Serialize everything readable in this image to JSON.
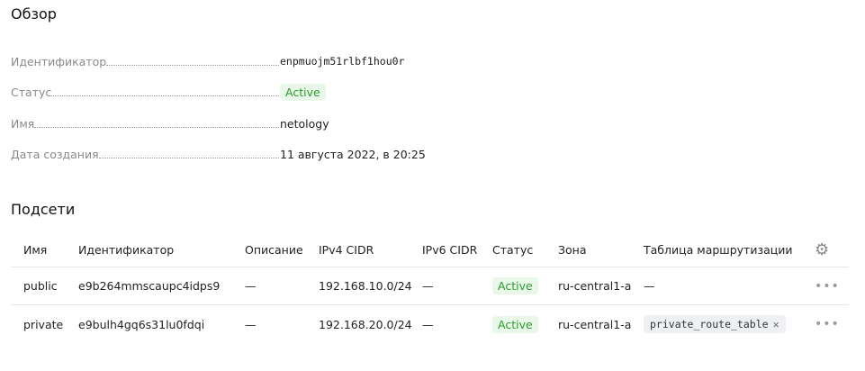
{
  "overview": {
    "title": "Обзор",
    "fields": [
      {
        "label": "Идентификатор",
        "value": "enpmuojm51rlbf1hou0r"
      },
      {
        "label": "Статус",
        "value": "Active"
      },
      {
        "label": "Имя",
        "value": "netology"
      },
      {
        "label": "Дата создания",
        "value": "11 августа 2022, в 20:25"
      }
    ]
  },
  "subnets": {
    "title": "Подсети",
    "columns": [
      "Имя",
      "Идентификатор",
      "Описание",
      "IPv4 CIDR",
      "IPv6 CIDR",
      "Статус",
      "Зона",
      "Таблица маршрутизации"
    ],
    "settings_icon": "gear-icon",
    "rows": [
      {
        "name": "public",
        "id": "e9b264mmscaupc4idps9",
        "description": "—",
        "ipv4": "192.168.10.0/24",
        "ipv6": "—",
        "status": "Active",
        "zone": "ru-central1-a",
        "route_table": "—",
        "menu": "•••"
      },
      {
        "name": "private",
        "id": "e9bulh4gq6s31lu0fdqi",
        "description": "—",
        "ipv4": "192.168.20.0/24",
        "ipv6": "—",
        "status": "Active",
        "zone": "ru-central1-a",
        "route_table": "private_route_table",
        "remove": "✕",
        "menu": "•••"
      }
    ]
  },
  "colors": {
    "active_bg": "#eaf8ea",
    "active_text": "#2a9c2a"
  }
}
